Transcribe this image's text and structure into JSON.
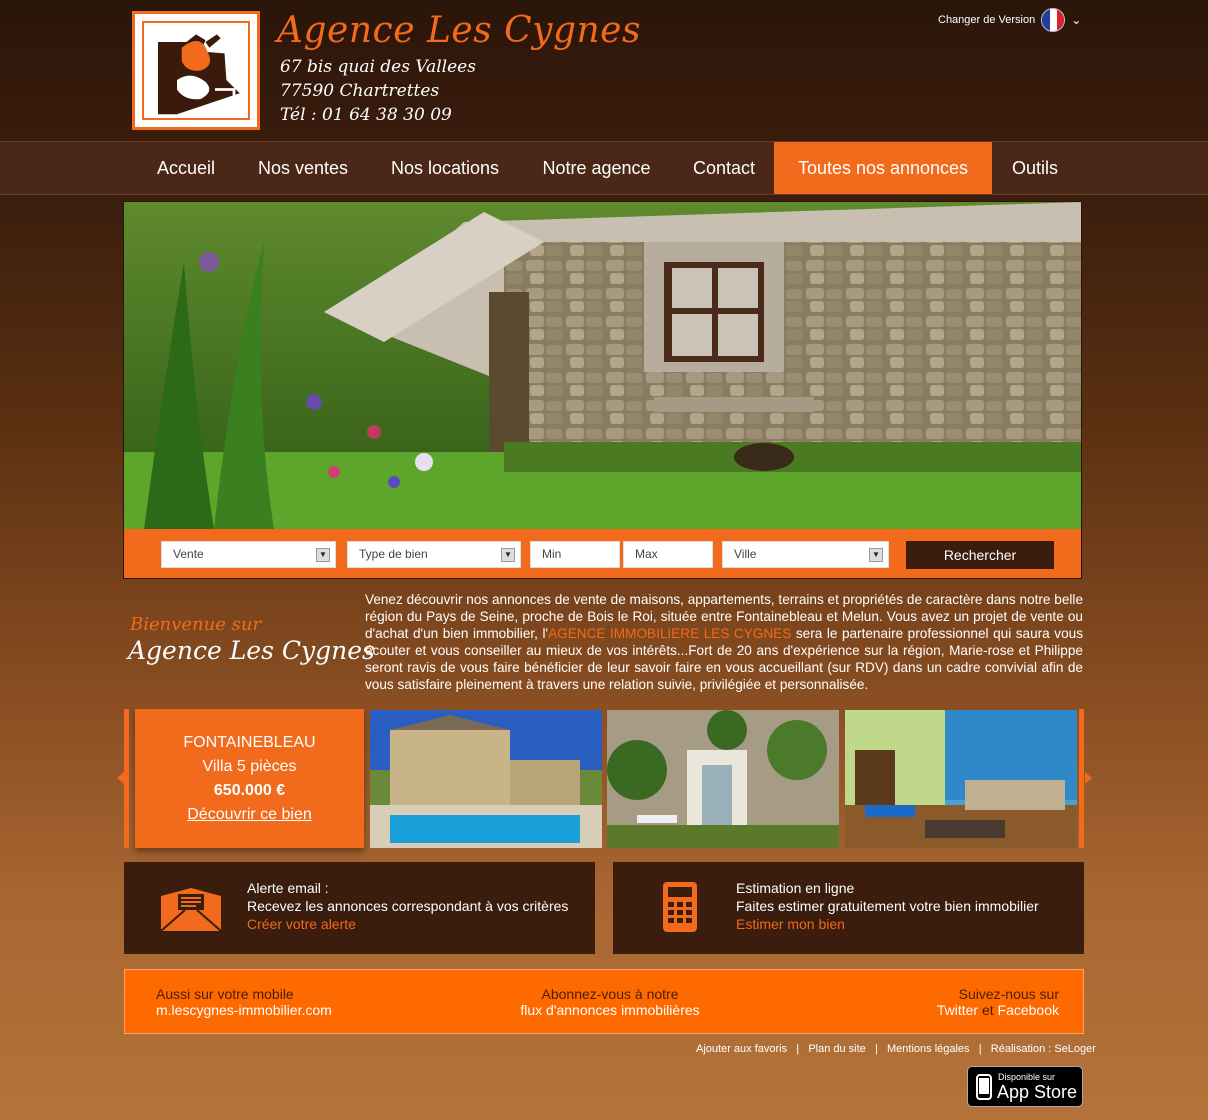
{
  "header": {
    "agency_name": "Agence Les Cygnes",
    "address_line1": "67 bis quai des Vallees",
    "address_line2": "77590 Chartrettes",
    "phone": "Tél : 01 64 38 30 09",
    "version_label": "Changer de Version"
  },
  "nav": {
    "items": [
      "Accueil",
      "Nos ventes",
      "Nos locations",
      "Notre agence",
      "Contact",
      "Toutes nos annonces",
      "Outils"
    ],
    "active": "Toutes nos annonces"
  },
  "search": {
    "transaction": "Vente",
    "type": "Type de bien",
    "min_placeholder": "Min",
    "max_placeholder": "Max",
    "city": "Ville",
    "button": "Rechercher"
  },
  "welcome": {
    "line1": "Bienvenue sur",
    "line2": "Agence Les Cygnes",
    "text_before": "Venez découvrir nos annonces de vente de maisons, appartements, terrains et propriétés de caractère dans notre belle région du Pays de Seine, proche de Bois le Roi, située entre Fontainebleau et Melun. Vous avez un projet de vente ou d'achat d'un bien immobilier, l'",
    "highlight": "AGENCE IMMOBILIERE LES CYGNES",
    "text_after": " sera le partenaire professionnel qui saura vous écouter et vous conseiller au mieux de vos intérêts...Fort de 20 ans d'expérience sur la région, Marie-rose et Philippe seront ravis de vous faire bénéficier de leur savoir faire en vous accueillant (sur RDV) dans un cadre convivial afin de vous satisfaire pleinement à travers une relation suivie, privilégiée et personnalisée."
  },
  "featured": {
    "city": "FONTAINEBLEAU",
    "type": "Villa 5 pièces",
    "price": "650.000 €",
    "link": "Découvrir ce bien"
  },
  "alert_box": {
    "title": "Alerte email :",
    "text": "Recevez les annonces correspondant à vos critères",
    "link": "Créer votre alerte"
  },
  "estimate_box": {
    "title": "Estimation en ligne",
    "text": "Faites estimer gratuitement votre bien immobilier",
    "link": "Estimer mon bien"
  },
  "band": {
    "mobile_label": "Aussi sur votre mobile",
    "mobile_url": "m.lescygnes-immobilier.com",
    "feed_line1": "Abonnez-vous à notre",
    "feed_line2": "flux d'annonces immobilières",
    "follow": "Suivez-nous sur",
    "twitter": "Twitter",
    "and": "et",
    "facebook": "Facebook"
  },
  "footer_links": {
    "favorites": "Ajouter aux favoris",
    "sitemap": "Plan du site",
    "legal": "Mentions légales",
    "credit": "Réalisation : SeLoger",
    "separator": "|"
  },
  "appstore": {
    "line1": "Disponible sur",
    "line2": "App Store"
  },
  "colors": {
    "accent": "#f26a1b",
    "dark": "#3a1d0c",
    "nav_bg": "#4a2716"
  }
}
